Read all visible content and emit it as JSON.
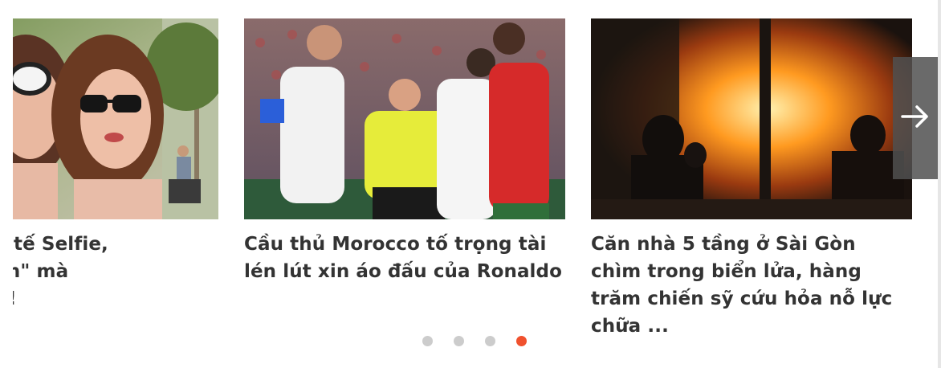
{
  "slides": [
    {
      "title_lines": [
        "Ngày Quốc tế Selfie,",
        "nh \"lừa tình\" mà",
        "nh giá nhé!"
      ],
      "title_visible_lines": [
        "ngày Quốc tế Selfie,",
        "nh \"lừa tình\" mà",
        "nh giá nhé!"
      ]
    },
    {
      "title": "Cầu thủ Morocco tố trọng tài lén lút xin áo đấu của Ronaldo"
    },
    {
      "title": "Căn nhà 5 tầng ở Sài Gòn chìm trong biển lửa, hàng trăm chiến sỹ cứu hỏa nỗ lực chữa ..."
    }
  ],
  "pagination": {
    "count": 4,
    "active_index": 3
  },
  "colors": {
    "active_dot": "#f0512e",
    "inactive_dot": "#cccccc",
    "title_text": "#333333"
  },
  "icons": {
    "next": "arrow-right-icon"
  }
}
